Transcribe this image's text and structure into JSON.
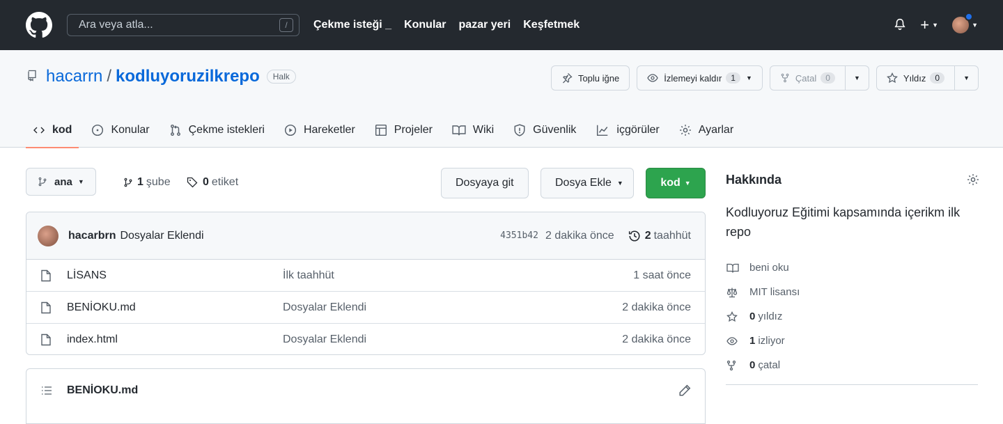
{
  "header": {
    "search_placeholder": "Ara veya atla...",
    "slash_key": "/",
    "nav": [
      "Çekme isteği _",
      "Konular",
      "pazar yeri",
      "Keşfetmek"
    ]
  },
  "repo": {
    "owner": "hacarrn",
    "separator": "/",
    "name": "kodluyoruzilkrepo",
    "visibility": "Halk",
    "pin_label": "Toplu iğne",
    "watch_label": "İzlemeyi kaldır",
    "watch_count": "1",
    "fork_label": "Çatal",
    "fork_count": "0",
    "star_label": "Yıldız",
    "star_count": "0"
  },
  "tabs": [
    {
      "label": "kod"
    },
    {
      "label": "Konular"
    },
    {
      "label": "Çekme istekleri"
    },
    {
      "label": "Hareketler"
    },
    {
      "label": "Projeler"
    },
    {
      "label": "Wiki"
    },
    {
      "label": "Güvenlik"
    },
    {
      "label": "içgörüler"
    },
    {
      "label": "Ayarlar"
    }
  ],
  "branchbar": {
    "branch": "ana",
    "branches_count": "1",
    "branches_label": "şube",
    "tags_count": "0",
    "tags_label": "etiket",
    "goto_file": "Dosyaya git",
    "add_file": "Dosya Ekle",
    "code": "kod"
  },
  "commit": {
    "author": "hacarbrn",
    "message": "Dosyalar Eklendi",
    "sha": "4351b42",
    "ago": "2 dakika önce",
    "history_count": "2",
    "history_label": "taahhüt"
  },
  "files": [
    {
      "name": "LİSANS",
      "message": "İlk taahhüt",
      "age": "1 saat önce"
    },
    {
      "name": "BENİOKU.md",
      "message": "Dosyalar Eklendi",
      "age": "2 dakika önce"
    },
    {
      "name": "index.html",
      "message": "Dosyalar Eklendi",
      "age": "2 dakika önce"
    }
  ],
  "readme": {
    "title": "BENİOKU.md"
  },
  "about": {
    "title": "Hakkında",
    "description": "Kodluyoruz Eğitimi kapsamında içerikm ilk repo",
    "readme_link": "beni oku",
    "license": "MIT lisansı",
    "stars_count": "0",
    "stars_label": "yıldız",
    "watching_count": "1",
    "watching_label": "izliyor",
    "forks_count": "0",
    "forks_label": "çatal"
  }
}
